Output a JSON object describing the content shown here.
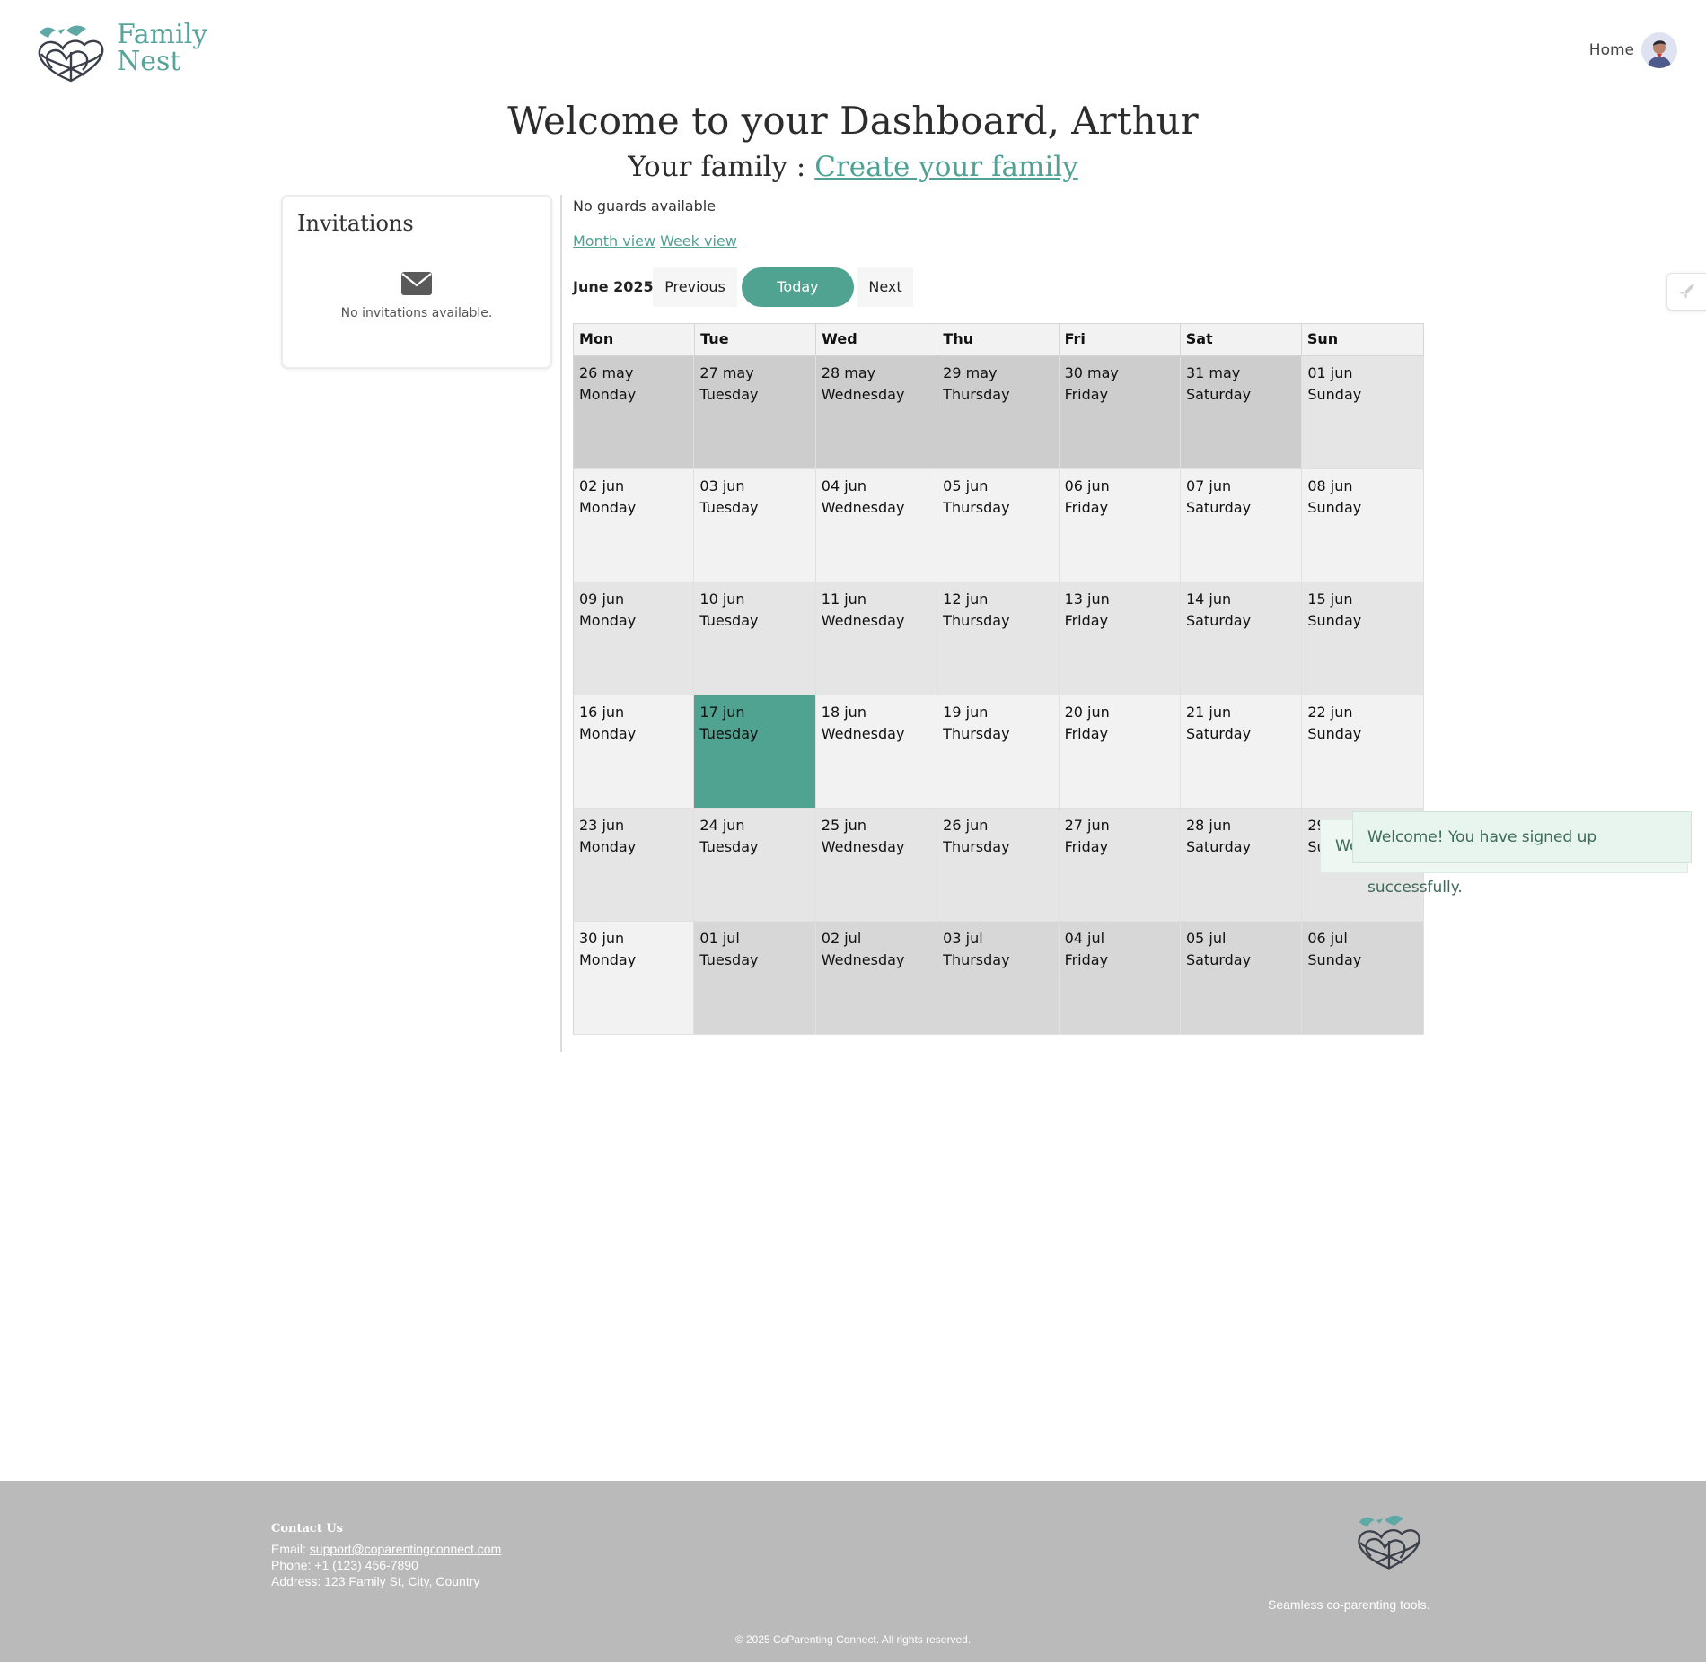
{
  "brand": {
    "name_line1": "Family",
    "name_line2": "Nest"
  },
  "nav": {
    "home_label": "Home"
  },
  "page": {
    "title": "Welcome to your Dashboard, Arthur",
    "family_label": "Your family :",
    "family_link": "Create your family"
  },
  "invitations": {
    "title": "Invitations",
    "empty_text": "No invitations available."
  },
  "guards": {
    "status": "No guards available"
  },
  "views": {
    "month": "Month view",
    "week": "Week view"
  },
  "calendar": {
    "label": "June 2025",
    "prev": "Previous",
    "today": "Today",
    "next": "Next",
    "headers": [
      "Mon",
      "Tue",
      "Wed",
      "Thu",
      "Fri",
      "Sat",
      "Sun"
    ],
    "today_color": "#4fa390",
    "weeks": [
      [
        {
          "date": "26 may",
          "day": "Monday",
          "tone": "dark"
        },
        {
          "date": "27 may",
          "day": "Tuesday",
          "tone": "dark"
        },
        {
          "date": "28 may",
          "day": "Wednesday",
          "tone": "dark"
        },
        {
          "date": "29 may",
          "day": "Thursday",
          "tone": "dark"
        },
        {
          "date": "30 may",
          "day": "Friday",
          "tone": "dark"
        },
        {
          "date": "31 may",
          "day": "Saturday",
          "tone": "dark"
        },
        {
          "date": "01 jun",
          "day": "Sunday",
          "tone": "mid"
        }
      ],
      [
        {
          "date": "02 jun",
          "day": "Monday",
          "tone": "light"
        },
        {
          "date": "03 jun",
          "day": "Tuesday",
          "tone": "light"
        },
        {
          "date": "04 jun",
          "day": "Wednesday",
          "tone": "light"
        },
        {
          "date": "05 jun",
          "day": "Thursday",
          "tone": "light"
        },
        {
          "date": "06 jun",
          "day": "Friday",
          "tone": "light"
        },
        {
          "date": "07 jun",
          "day": "Saturday",
          "tone": "light"
        },
        {
          "date": "08 jun",
          "day": "Sunday",
          "tone": "light"
        }
      ],
      [
        {
          "date": "09 jun",
          "day": "Monday",
          "tone": "mid"
        },
        {
          "date": "10 jun",
          "day": "Tuesday",
          "tone": "mid"
        },
        {
          "date": "11 jun",
          "day": "Wednesday",
          "tone": "mid"
        },
        {
          "date": "12 jun",
          "day": "Thursday",
          "tone": "mid"
        },
        {
          "date": "13 jun",
          "day": "Friday",
          "tone": "mid"
        },
        {
          "date": "14 jun",
          "day": "Saturday",
          "tone": "mid"
        },
        {
          "date": "15 jun",
          "day": "Sunday",
          "tone": "mid"
        }
      ],
      [
        {
          "date": "16 jun",
          "day": "Monday",
          "tone": "light"
        },
        {
          "date": "17 jun",
          "day": "Tuesday",
          "tone": "today"
        },
        {
          "date": "18 jun",
          "day": "Wednesday",
          "tone": "light"
        },
        {
          "date": "19 jun",
          "day": "Thursday",
          "tone": "light"
        },
        {
          "date": "20 jun",
          "day": "Friday",
          "tone": "light"
        },
        {
          "date": "21 jun",
          "day": "Saturday",
          "tone": "light"
        },
        {
          "date": "22 jun",
          "day": "Sunday",
          "tone": "light"
        }
      ],
      [
        {
          "date": "23 jun",
          "day": "Monday",
          "tone": "mid"
        },
        {
          "date": "24 jun",
          "day": "Tuesday",
          "tone": "mid"
        },
        {
          "date": "25 jun",
          "day": "Wednesday",
          "tone": "mid"
        },
        {
          "date": "26 jun",
          "day": "Thursday",
          "tone": "mid"
        },
        {
          "date": "27 jun",
          "day": "Friday",
          "tone": "mid"
        },
        {
          "date": "28 jun",
          "day": "Saturday",
          "tone": "mid"
        },
        {
          "date": "29 jun",
          "day": "Sunday",
          "tone": "mid"
        }
      ],
      [
        {
          "date": "30 jun",
          "day": "Monday",
          "tone": "light"
        },
        {
          "date": "01 jul",
          "day": "Tuesday",
          "tone": "next"
        },
        {
          "date": "02 jul",
          "day": "Wednesday",
          "tone": "next"
        },
        {
          "date": "03 jul",
          "day": "Thursday",
          "tone": "next"
        },
        {
          "date": "04 jul",
          "day": "Friday",
          "tone": "next"
        },
        {
          "date": "05 jul",
          "day": "Saturday",
          "tone": "next"
        },
        {
          "date": "06 jul",
          "day": "Sunday",
          "tone": "next"
        }
      ]
    ]
  },
  "toasts": {
    "back": "Welcome! You have signed up successfully.",
    "front": "Welcome! You have signed up successfully."
  },
  "footer": {
    "contact_heading": "Contact Us",
    "email_label": "Email:",
    "email": "support@coparentingconnect.com",
    "phone": "Phone: +1 (123) 456-7890",
    "address": "Address: 123 Family St, City, Country",
    "tagline": "Seamless co-parenting tools.",
    "copyright": "© 2025 CoParenting Connect. All rights reserved."
  },
  "icons": {
    "logo": "family-nest-logo",
    "invitations": "envelope-icon",
    "side_tab": "rocket-icon",
    "avatar": "user-avatar"
  },
  "colors": {
    "accent": "#4fa295",
    "footer_bg": "#bbbabb"
  }
}
